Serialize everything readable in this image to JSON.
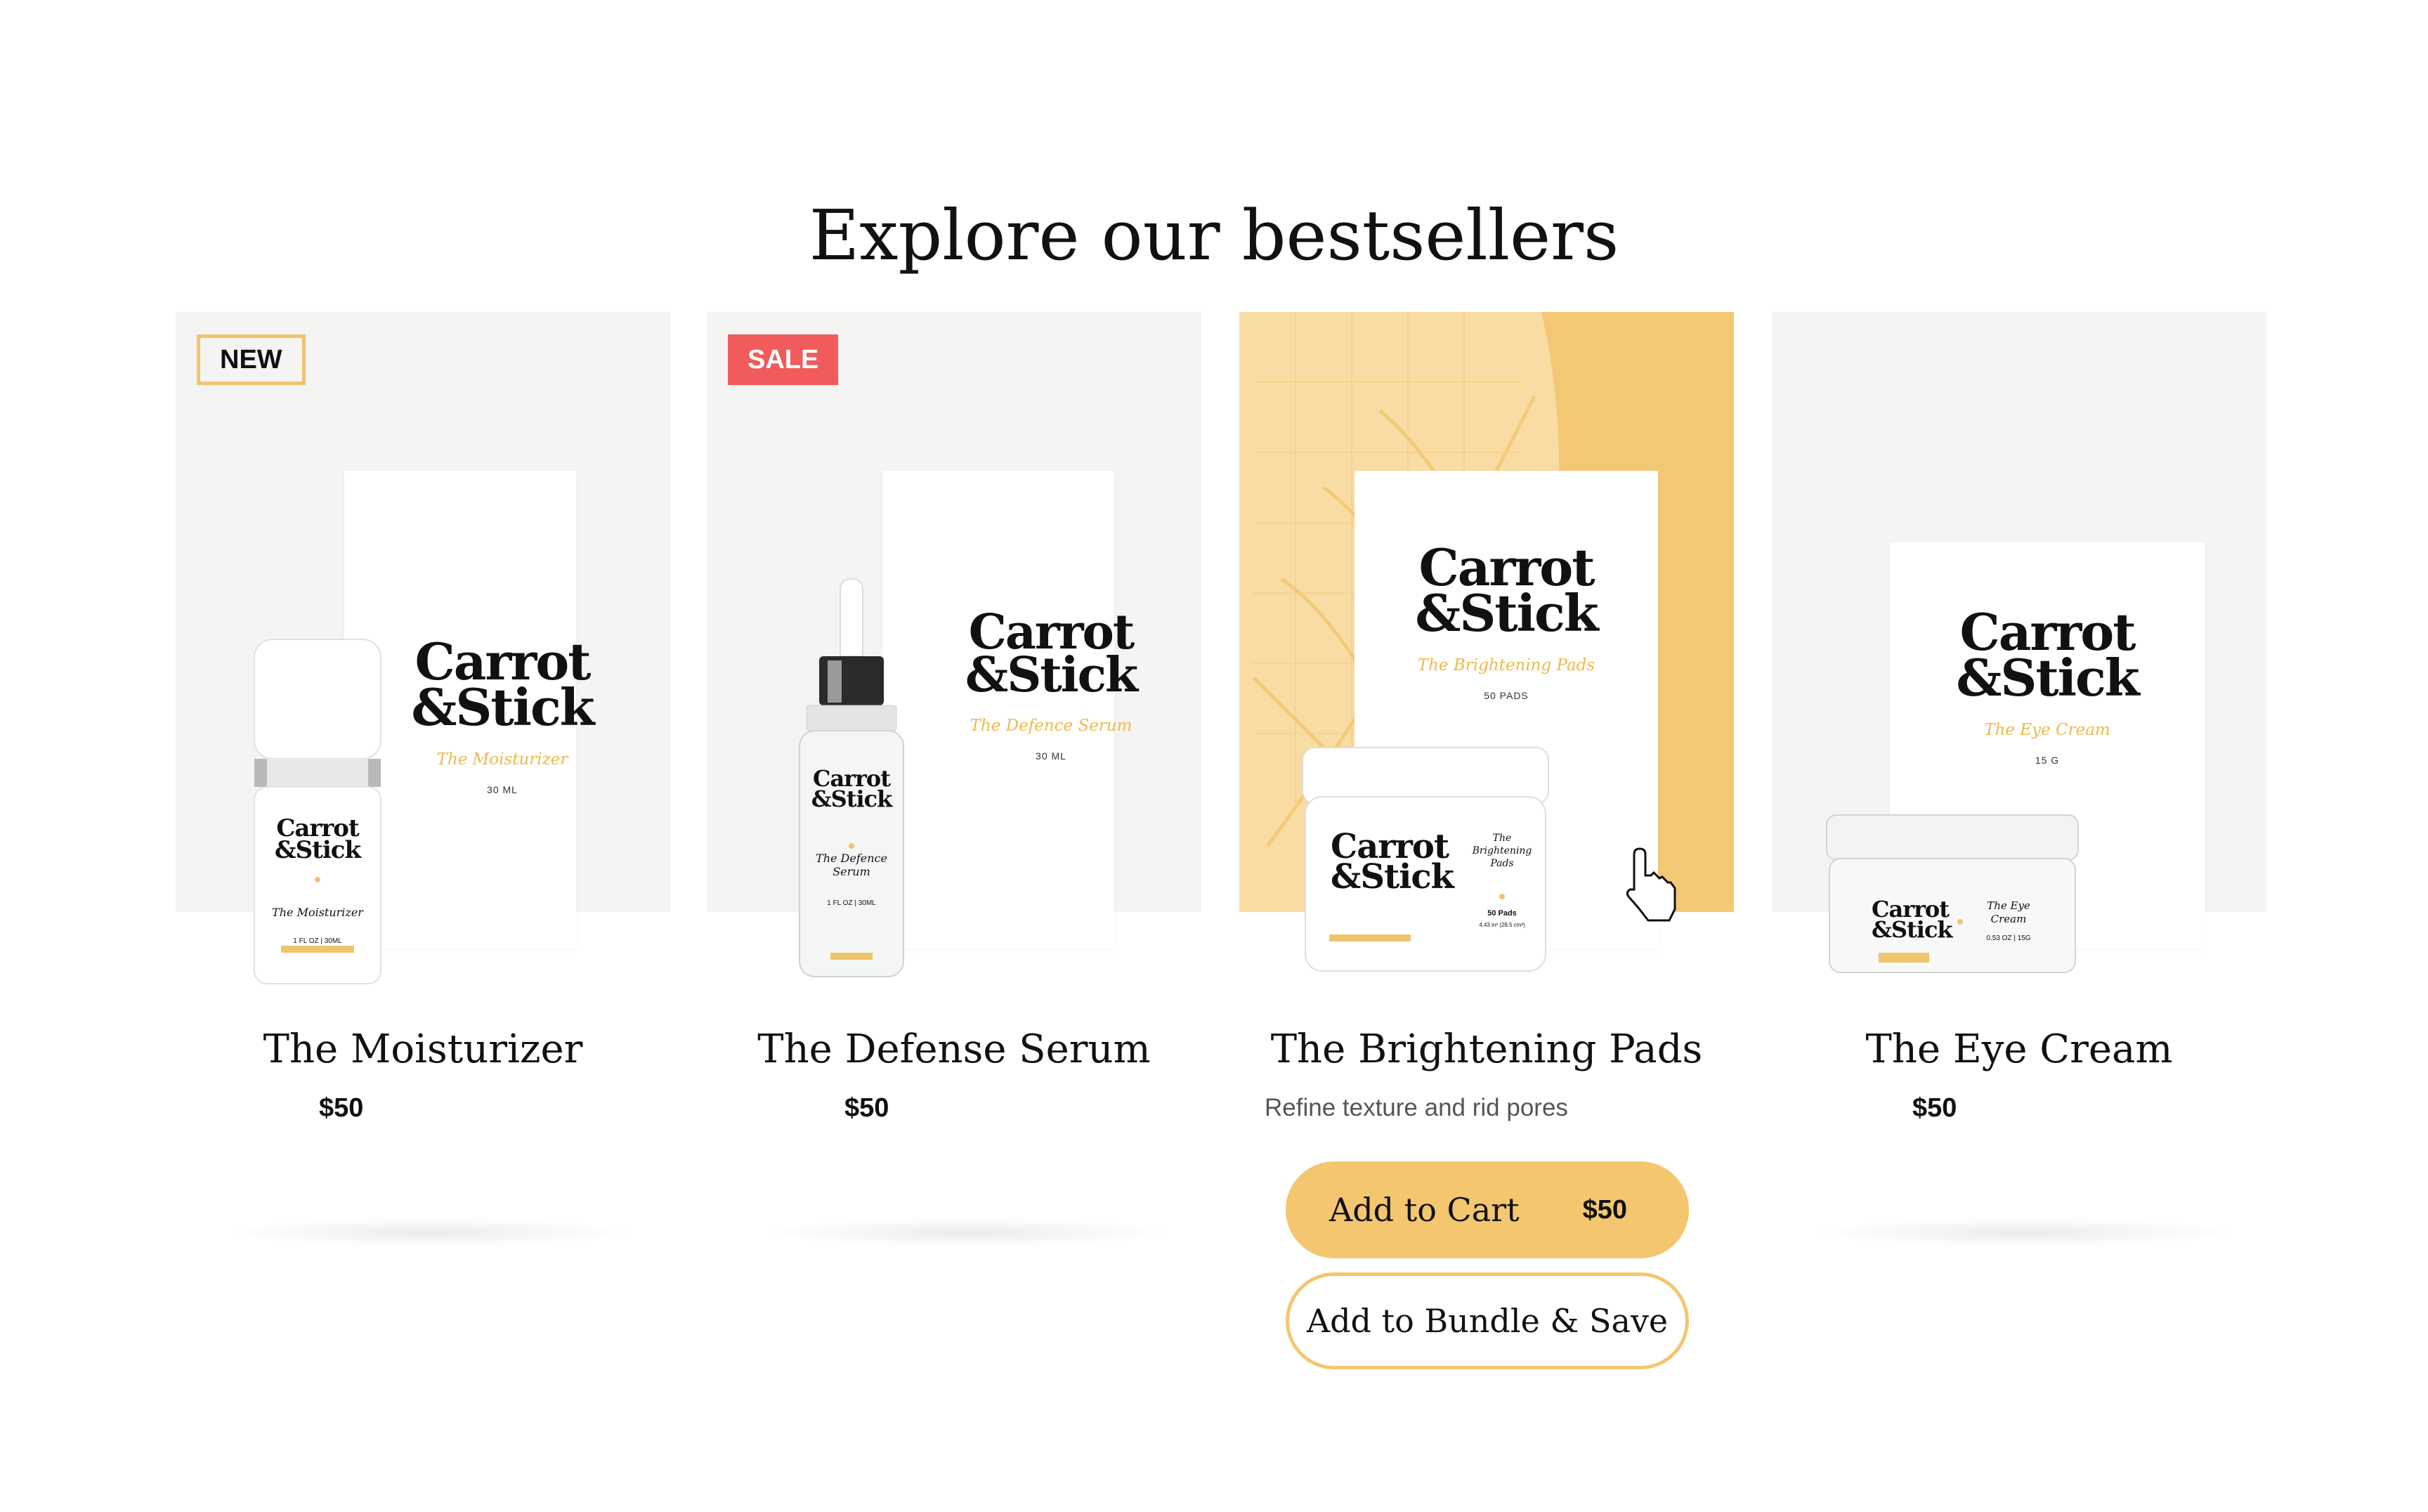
{
  "section": {
    "title": "Explore our bestsellers"
  },
  "colors": {
    "accent": "#f3c66f",
    "sale": "#f25b5b",
    "tile": "#f4f4f2"
  },
  "products": [
    {
      "name": "The Moisturizer",
      "price": "$50",
      "badge": "NEW",
      "box": {
        "brand_line1": "Carrot",
        "brand_line2": "&Stick",
        "subtitle": "The Moisturizer",
        "size": "30 ML"
      },
      "bottle": {
        "brand_line1": "Carrot",
        "brand_line2": "&Stick",
        "label": "The Moisturizer",
        "size": "1 FL OZ | 30ML"
      }
    },
    {
      "name": "The Defense Serum",
      "price": "$50",
      "badge": "SALE",
      "box": {
        "brand_line1": "Carrot",
        "brand_line2": "&Stick",
        "subtitle": "The Defence Serum",
        "size": "30 ML"
      },
      "bottle": {
        "brand_line1": "Carrot",
        "brand_line2": "&Stick",
        "label": "The Defence Serum",
        "size": "1 FL OZ | 30ML"
      }
    },
    {
      "name": "The Brightening Pads",
      "description": "Refine texture and rid pores",
      "box": {
        "brand_line1": "Carrot",
        "brand_line2": "&Stick",
        "subtitle": "The Brightening Pads",
        "size": "50 PADS"
      },
      "jar": {
        "brand_line1": "Carrot",
        "brand_line2": "&Stick",
        "label": "The Brightening Pads",
        "count": "50 Pads",
        "size": "4.43 in² (28.5 cm²)"
      },
      "add_to_cart": {
        "label": "Add to Cart",
        "price": "$50"
      },
      "add_to_bundle": {
        "label": "Add to Bundle & Save"
      }
    },
    {
      "name": "The Eye Cream",
      "price": "$50",
      "box": {
        "brand_line1": "Carrot",
        "brand_line2": "&Stick",
        "subtitle": "The Eye Cream",
        "size": "15 G"
      },
      "jar": {
        "brand_line1": "Carrot",
        "brand_line2": "&Stick",
        "label": "The Eye Cream",
        "size": "0.53 OZ | 15G"
      }
    }
  ]
}
